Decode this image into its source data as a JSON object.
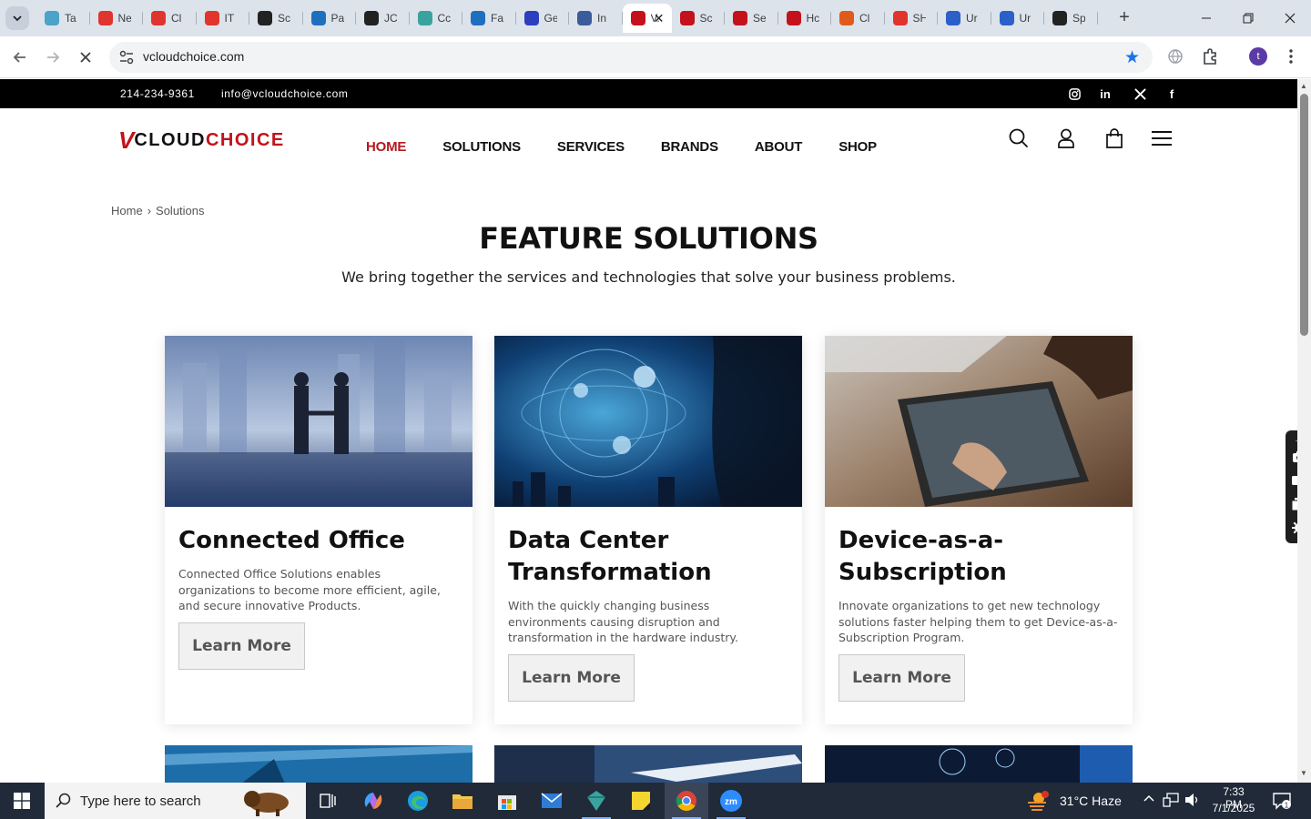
{
  "browser": {
    "tabs": [
      {
        "title": "Ta",
        "icon": "hexagon-icon",
        "color": "#4aa3c9"
      },
      {
        "title": "Ne",
        "icon": "diamond-icon",
        "color": "#e0342f"
      },
      {
        "title": "Cl",
        "icon": "diamond-icon",
        "color": "#e0342f"
      },
      {
        "title": "IT",
        "icon": "diamond-icon",
        "color": "#e0342f"
      },
      {
        "title": "Sc",
        "icon": "gear-face-icon",
        "color": "#222222"
      },
      {
        "title": "Pa",
        "icon": "gauge-icon",
        "color": "#1f6fbf"
      },
      {
        "title": "JC",
        "icon": "target-icon",
        "color": "#222222"
      },
      {
        "title": "Cc",
        "icon": "hexagon-icon",
        "color": "#3aa3a0"
      },
      {
        "title": "Fa",
        "icon": "scales-icon",
        "color": "#1f6fbf"
      },
      {
        "title": "Ge",
        "icon": "x-icon",
        "color": "#2b3fbf"
      },
      {
        "title": "In",
        "icon": "check-icon",
        "color": "#3a5c9a"
      },
      {
        "title": "V.",
        "icon": "v-logo-icon",
        "color": "#c3121b",
        "active": true
      },
      {
        "title": "Sc",
        "icon": "v-logo-icon",
        "color": "#c3121b"
      },
      {
        "title": "Se",
        "icon": "v-logo-icon",
        "color": "#c3121b"
      },
      {
        "title": "Hc",
        "icon": "ball-icon",
        "color": "#c3121b"
      },
      {
        "title": "Cl",
        "icon": "flame-icon",
        "color": "#e05a1c"
      },
      {
        "title": "SH",
        "icon": "ring-icon",
        "color": "#e0342f"
      },
      {
        "title": "Ur",
        "icon": "doc-icon",
        "color": "#2b5fc9"
      },
      {
        "title": "Ur",
        "icon": "doc-icon",
        "color": "#2b5fc9"
      },
      {
        "title": "Sp",
        "icon": "target-icon",
        "color": "#222222"
      }
    ],
    "url": "vcloudchoice.com",
    "profile_initial": "t"
  },
  "site": {
    "topbar": {
      "phone": "214-234-9361",
      "email": "info@vcloudchoice.com",
      "social": [
        "instagram-icon",
        "linkedin-icon",
        "x-twitter-icon",
        "facebook-icon"
      ]
    },
    "logo": {
      "v": "V",
      "part1": "CLOUD",
      "part2": "CHOICE"
    },
    "nav": [
      "HOME",
      "SOLUTIONS",
      "SERVICES",
      "BRANDS",
      "ABOUT",
      "SHOP"
    ],
    "breadcrumb": {
      "home": "Home",
      "sep": "›",
      "current": "Solutions"
    },
    "title": "FEATURE SOLUTIONS",
    "subtitle": "We bring together the services and technologies that solve your business problems.",
    "cards": [
      {
        "title": "Connected Office",
        "text": "Connected Office Solutions enables organizations to become more efficient, agile, and secure innovative Products.",
        "button": "Learn More"
      },
      {
        "title": "Data Center Transformation",
        "text": "With the quickly changing business environments causing disruption and transformation in the hardware industry.",
        "button": "Learn More"
      },
      {
        "title": "Device-as-a-Subscription",
        "text": "Innovate organizations to get new technology solutions faster helping them to get Device-as-a-Subscription Program.",
        "button": "Learn More"
      }
    ],
    "accent_color": "#c3121b"
  },
  "taskbar": {
    "search_placeholder": "Type here to search",
    "weather": "31°C  Haze",
    "weather_badge": "1",
    "time": "7:33 PM",
    "date": "7/1/2025",
    "notification_count": "1"
  }
}
